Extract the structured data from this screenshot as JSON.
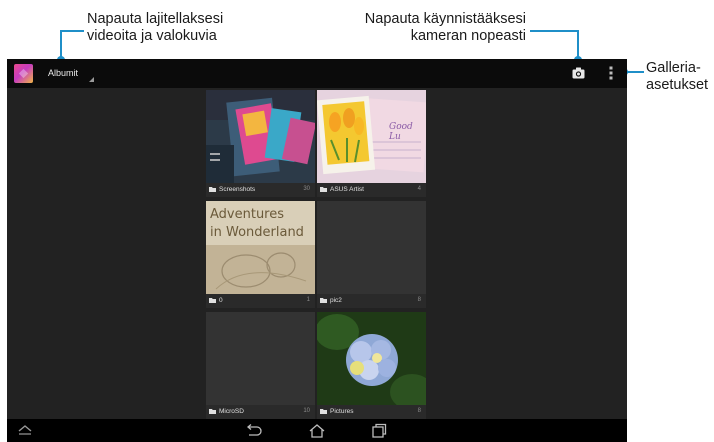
{
  "callouts": {
    "sort": {
      "line1": "Napauta lajitellaksesi",
      "line2": "videoita ja valokuvia"
    },
    "camera": {
      "line1": "Napauta käynnistääksesi",
      "line2": "kameran nopeasti"
    },
    "settings": {
      "line1": "Galleria-",
      "line2": "asetukset"
    }
  },
  "action_bar": {
    "album_label": "Albumit",
    "app_icon": "gallery-app-icon",
    "camera_icon": "camera-icon",
    "overflow_icon": "overflow-menu-icon"
  },
  "albums": [
    {
      "name": "Screenshots",
      "count": "30"
    },
    {
      "name": "ASUS Artist",
      "count": "4"
    },
    {
      "name": "0",
      "count": "1"
    },
    {
      "name": "pic2",
      "count": "8"
    },
    {
      "name": "MicroSD",
      "count": "10"
    },
    {
      "name": "Pictures",
      "count": "8"
    }
  ],
  "thumbnail_text": {
    "wonderland_line1": "Adventures",
    "wonderland_line2": "in Wonderland",
    "card_text": "Good Lu"
  },
  "nav_bar": {
    "icons": [
      "collapse-icon",
      "back-icon",
      "home-icon",
      "recent-apps-icon"
    ]
  },
  "colors": {
    "accent": "#1f8fc8",
    "screen_bg": "#222222",
    "action_bar_bg": "#0b0b0b"
  }
}
